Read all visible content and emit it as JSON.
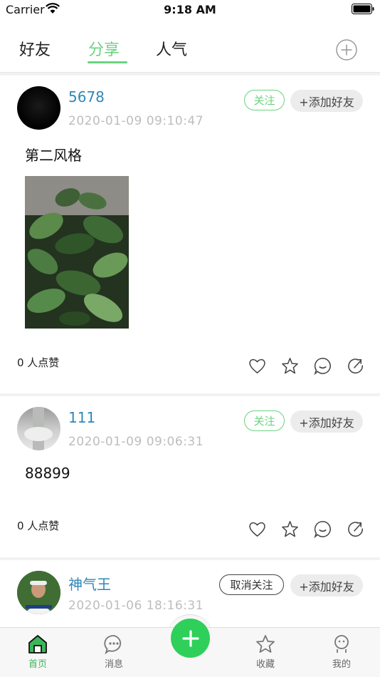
{
  "status": {
    "carrier": "Carrier",
    "time": "9:18 AM"
  },
  "nav": {
    "tabs": [
      {
        "label": "好友"
      },
      {
        "label": "分享"
      },
      {
        "label": "人气"
      }
    ],
    "active_tab": "分享"
  },
  "posts": [
    {
      "username": "5678",
      "timestamp": "2020-01-09 09:10:47",
      "follow_label": "关注",
      "add_friend_label": "+添加好友",
      "text": "第二风格",
      "likes": "0 人点赞"
    },
    {
      "username": "111",
      "timestamp": "2020-01-09 09:06:31",
      "follow_label": "关注",
      "add_friend_label": "+添加好友",
      "text": "88899",
      "likes": "0 人点赞"
    },
    {
      "username": "神气王",
      "timestamp": "2020-01-06 18:16:31",
      "follow_label": "取消关注",
      "add_friend_label": "+添加好友"
    }
  ],
  "bottom_tabs": [
    {
      "label": "首页",
      "icon": "home-icon",
      "active": true
    },
    {
      "label": "消息",
      "icon": "message-icon",
      "active": false
    },
    {
      "label": "收藏",
      "icon": "star-icon",
      "active": false
    },
    {
      "label": "我的",
      "icon": "profile-icon",
      "active": false
    }
  ],
  "colors": {
    "accent": "#6ad37f",
    "username": "#2f88b8",
    "publish": "#2fd05a",
    "active_tab": "#3cb65a"
  }
}
